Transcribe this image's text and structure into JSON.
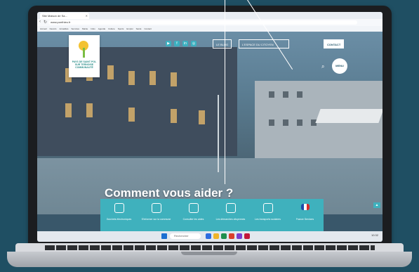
{
  "browser": {
    "tab_title": "Site Maison de Sa...",
    "url": "www.ponthieu.fr",
    "bookmarks": [
      "Accueil",
      "Favoris",
      "Actualités",
      "Services",
      "Mairie",
      "Infos",
      "Agenda",
      "Culture",
      "Sports",
      "Emploi",
      "Santé",
      "Contact"
    ]
  },
  "site": {
    "logo_text": "PAYS DE SAINT POL SUR TERNOISE COMMUNAUTÉ",
    "social_icons": [
      "youtube-icon",
      "facebook-icon",
      "linkedin-icon",
      "instagram-icon"
    ],
    "nav": {
      "button1": "LE BLOG",
      "button2": "L'ESPACE DU CITOYEN",
      "button3": "CONTACT"
    },
    "menu_label": "MENU",
    "headline": "Comment vous aider ?",
    "help_items": [
      "Guichets électroniques",
      "S'informer sur la commune",
      "Consulter les aides",
      "Les démarches citoyennes",
      "Les transports scolaires",
      "France Services"
    ]
  },
  "taskbar": {
    "search_placeholder": "Rechercher",
    "time": "10:32"
  },
  "colors": {
    "accent": "#3fb1bd",
    "background": "#1f4f63"
  }
}
